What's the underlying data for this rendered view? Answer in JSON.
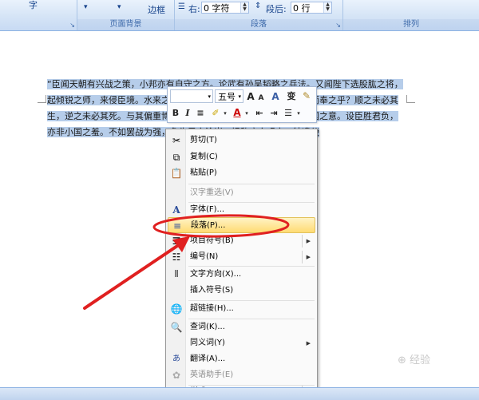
{
  "ribbon": {
    "groups": [
      {
        "label": "",
        "items": [
          "字"
        ]
      },
      {
        "label": "页面背景",
        "items": [
          "边框"
        ]
      },
      {
        "label": "段落",
        "items": []
      },
      {
        "label": "排列",
        "items": []
      }
    ],
    "indent_right_label": "右:",
    "indent_right_value": "0 字符",
    "spacing_after_label": "段后:",
    "spacing_after_value": "0 行"
  },
  "document": {
    "text": "“臣闻天朝有兴战之策，小邦亦有自守之方。论武有孙吴韬略之兵法。又闻陛下选股肱之将，起倾锐之师，来侵臣境。水来之地，山海之州，自有其备，岂肯跪途而奉之乎？顺之未必其生，逆之未必其死。与其偏重博戏，臣何惧哉。倘君胜臣负，且满上国之意。设臣胜君负，亦非小国之羞。不如罢战为强，免生灵之涂炭，拯黎庶之艰辛。特遣使"
  },
  "mini_toolbar": {
    "font_name": "",
    "font_size": "五号",
    "grow_font": "A",
    "shrink_font": "A",
    "style_btn": "A",
    "phonetic_btn": "变",
    "bold": "B",
    "italic": "I",
    "font_color": "A"
  },
  "context_menu": {
    "items": [
      {
        "label": "剪切(T)",
        "icon": "scissors-icon",
        "enabled": true
      },
      {
        "label": "复制(C)",
        "icon": "copy-icon",
        "enabled": true
      },
      {
        "label": "粘贴(P)",
        "icon": "paste-icon",
        "enabled": true
      },
      {
        "label": "汉字重选(V)",
        "icon": "",
        "enabled": false
      },
      {
        "label": "字体(F)...",
        "icon": "font-icon",
        "enabled": true
      },
      {
        "label": "段落(P)...",
        "icon": "paragraph-icon",
        "enabled": true,
        "highlighted": true
      },
      {
        "label": "项目符号(B)",
        "icon": "bullets-icon",
        "enabled": true,
        "submenu": true
      },
      {
        "label": "编号(N)",
        "icon": "numbering-icon",
        "enabled": true,
        "submenu": true
      },
      {
        "label": "文字方向(X)...",
        "icon": "text-direction-icon",
        "enabled": true
      },
      {
        "label": "插入符号(S)",
        "icon": "",
        "enabled": true
      },
      {
        "label": "超链接(H)...",
        "icon": "hyperlink-icon",
        "enabled": true
      },
      {
        "label": "查词(K)...",
        "icon": "lookup-icon",
        "enabled": true
      },
      {
        "label": "同义词(Y)",
        "icon": "",
        "enabled": true,
        "submenu": true
      },
      {
        "label": "翻译(A)...",
        "icon": "translate-icon",
        "enabled": true
      },
      {
        "label": "英语助手(E)",
        "icon": "english-assistant-icon",
        "enabled": false
      },
      {
        "label": "样式(T)",
        "icon": "",
        "enabled": true,
        "submenu": true
      }
    ]
  },
  "colors": {
    "selection": "#b6cdea",
    "annotation_red": "#e02020",
    "menu_highlight": "#ffdb73",
    "ribbon_bg": "#d5e4f6"
  }
}
